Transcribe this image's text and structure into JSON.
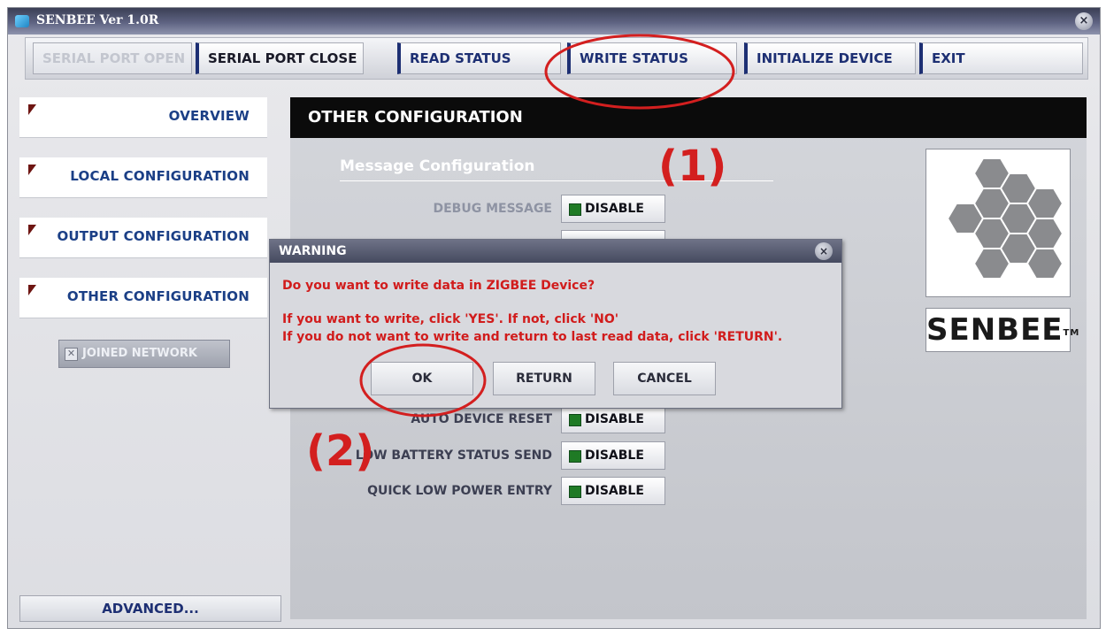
{
  "window": {
    "title": "SENBEE Ver 1.0R",
    "close_glyph": "×"
  },
  "toolbar": {
    "serial_open": "SERIAL PORT OPEN",
    "serial_close": "SERIAL PORT CLOSE",
    "read_status": "READ STATUS",
    "write_status": "WRITE STATUS",
    "initialize_device": "INITIALIZE DEVICE",
    "exit": "EXIT"
  },
  "sidebar": {
    "items": [
      {
        "label": "OVERVIEW"
      },
      {
        "label": "LOCAL CONFIGURATION"
      },
      {
        "label": "OUTPUT CONFIGURATION"
      },
      {
        "label": "OTHER CONFIGURATION"
      }
    ],
    "joined_network": {
      "label": "JOINED NETWORK",
      "checked": false,
      "glyph": "✕"
    },
    "advanced": "ADVANCED..."
  },
  "main": {
    "header": "OTHER CONFIGURATION",
    "section_title": "Message Configuration",
    "rows": [
      {
        "label": "DEBUG MESSAGE",
        "value": "DISABLE"
      },
      {
        "label": "AUTO DEVICE RESET",
        "value": "DISABLE"
      },
      {
        "label": "LOW BATTERY STATUS SEND",
        "value": "DISABLE"
      },
      {
        "label": "QUICK LOW POWER ENTRY",
        "value": "DISABLE"
      }
    ],
    "brand": "SENBEE",
    "brand_tm": "TM"
  },
  "dialog": {
    "title": "WARNING",
    "close_glyph": "×",
    "question": "Do you want to write data in ZIGBEE Device?",
    "line1": "If you want to write, click 'YES'. If not, click 'NO'",
    "line2": "If you do not want to write and return to last read data, click 'RETURN'.",
    "ok": "OK",
    "return": "RETURN",
    "cancel": "CANCEL"
  },
  "annotations": {
    "step1": "(1)",
    "step2": "(2)",
    "color": "#d31f1f"
  },
  "colors": {
    "accent_blue": "#1b3f86",
    "warning_red": "#d11c1c",
    "status_green": "#1f7a25"
  }
}
